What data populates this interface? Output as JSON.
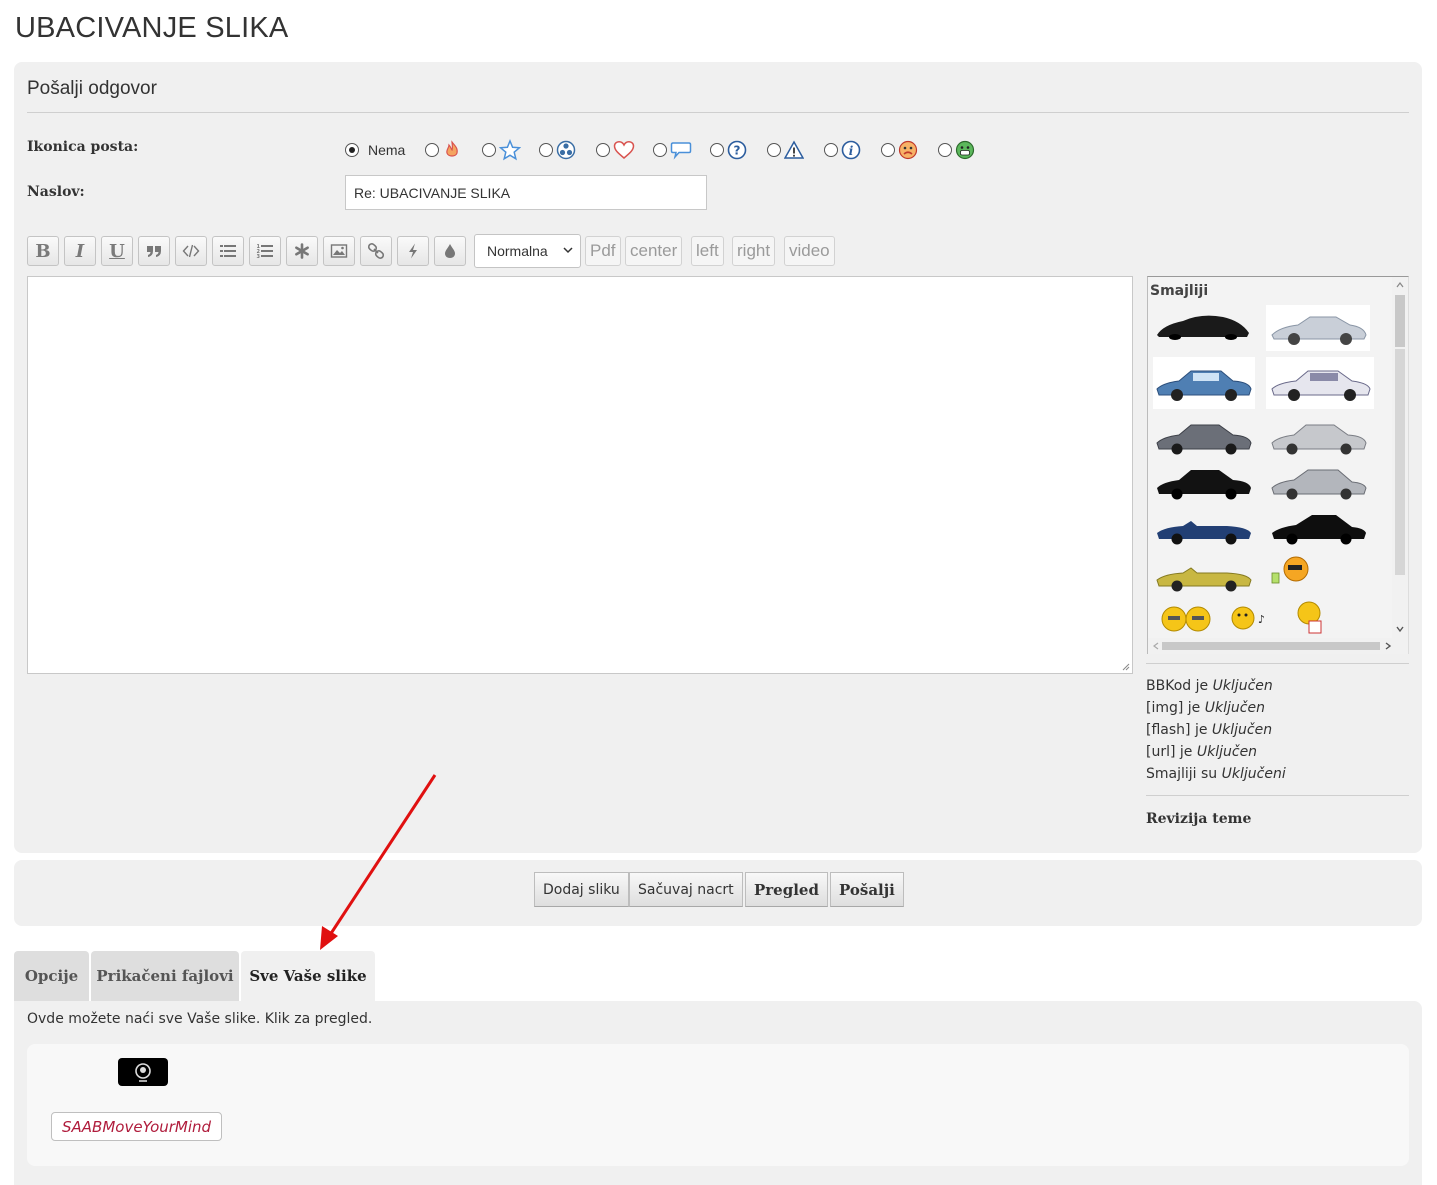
{
  "page": {
    "title": "UBACIVANJE SLIKA"
  },
  "reply": {
    "heading": "Pošalji odgovor",
    "icon_label": "Ikonica posta:",
    "icons": [
      {
        "name": "none",
        "label": "Nema",
        "selected": true
      },
      {
        "name": "fire-icon"
      },
      {
        "name": "star-icon"
      },
      {
        "name": "radioactive-icon"
      },
      {
        "name": "heart-icon"
      },
      {
        "name": "speech-bubble-icon"
      },
      {
        "name": "question-icon"
      },
      {
        "name": "warning-icon"
      },
      {
        "name": "info-icon"
      },
      {
        "name": "sad-face-icon"
      },
      {
        "name": "grin-face-icon"
      }
    ],
    "subject_label": "Naslov:",
    "subject_value": "Re: UBACIVANJE SLIKA"
  },
  "toolbar": {
    "buttons": [
      "B",
      "I",
      "U"
    ],
    "icon_buttons": [
      "quote-icon",
      "code-icon",
      "list-icon",
      "ordered-list-icon",
      "asterisk-icon",
      "image-icon",
      "link-icon",
      "flash-icon",
      "color-drop-icon"
    ],
    "font_size": "Normalna",
    "text_buttons": [
      "Pdf",
      "center",
      "left",
      "right",
      "video"
    ]
  },
  "smilies": {
    "title": "Smajliji"
  },
  "status": {
    "bbcode": {
      "label": "BBKod je",
      "value": "Uključen"
    },
    "img": {
      "label": "[img] je",
      "value": "Uključen"
    },
    "flash": {
      "label": "[flash] je",
      "value": "Uključen"
    },
    "url": {
      "label": "[url] je",
      "value": "Uključen"
    },
    "smilies": {
      "label": "Smajliji su",
      "value": "Uključeni"
    }
  },
  "topic_review": "Revizija teme",
  "actions": {
    "add_image": "Dodaj sliku",
    "save_draft": "Sačuvaj nacrt",
    "preview": "Pregled",
    "submit": "Pošalji"
  },
  "tabs": {
    "options": "Opcije",
    "attachments": "Prikačeni fajlovi",
    "your_images": "Sve Vaše slike"
  },
  "images_panel": {
    "description": "Ovde možete naći sve Vaše slike. Klik za pregled.",
    "image_name": "SAABMoveYourMind"
  },
  "colors": {
    "accent_red": "#e01010",
    "tag_text": "#b01c3c"
  }
}
